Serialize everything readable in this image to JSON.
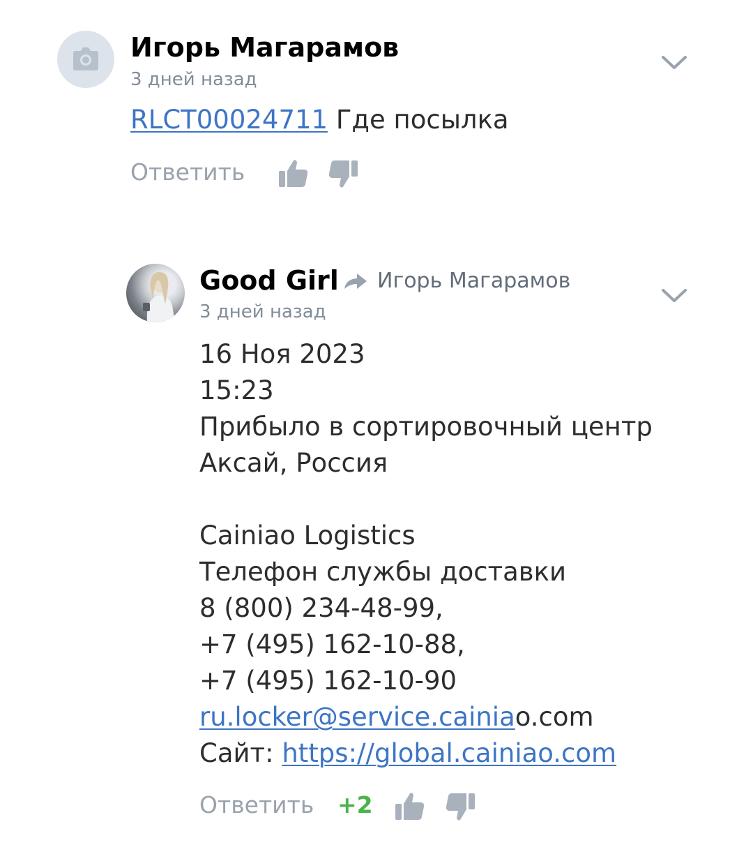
{
  "comments": [
    {
      "author": "Игорь Магарамов",
      "time": "3 дней назад",
      "tracking_link": "RLCT00024711",
      "text": "Где посылка",
      "reply_label": "Ответить"
    },
    {
      "author": "Good Girl",
      "reply_to": "Игорь Магарамов",
      "time": "3 дней назад",
      "lines": {
        "date": "16 Ноя 2023",
        "clock": "15:23",
        "status": "Прибыло в сортировочный центр",
        "place": "Аксай, Россия",
        "company": "Cainiao Logistics",
        "phone_title": "Телефон службы доставки",
        "phone_1": "8 (800) 234-48-99,",
        "phone_2": "+7 (495) 162-10-88,",
        "phone_3": "+7 (495) 162-10-90",
        "email_linked": "ru.locker@service.cainia",
        "email_rest": "o.com",
        "site_label": "Сайт: ",
        "site_url": "https://global.cainiao.com"
      },
      "reply_label": "Ответить",
      "rating": "+2"
    }
  ],
  "icons": {
    "avatar_placeholder": "camera-icon",
    "menu": "chevron-down-icon",
    "like": "thumbs-up-icon",
    "dislike": "thumbs-down-icon",
    "reply_to": "reply-arrow-icon"
  },
  "colors": {
    "link": "#3d75c5",
    "secondary_text": "#818c99",
    "action_gray": "#99a2ad",
    "rating_positive": "#4bb34b"
  }
}
